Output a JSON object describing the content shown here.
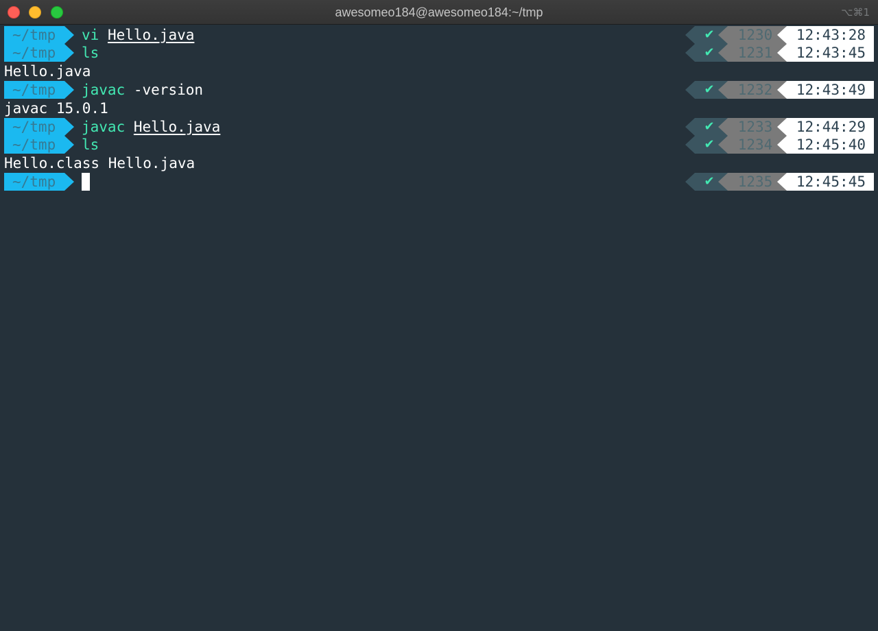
{
  "window": {
    "title": "awesomeo184@awesomeo184:~/tmp",
    "shortcut": "⌥⌘1"
  },
  "colors": {
    "background": "#25313a",
    "dir_segment": "#1bb9f0",
    "command": "#43e8b2",
    "status_segment": "#3b5560",
    "history_segment": "#7a7a7a",
    "time_segment": "#ffffff"
  },
  "terminal": {
    "lines": [
      {
        "type": "prompt",
        "dir": "~/tmp",
        "cmd": "vi",
        "arg": "Hello.java",
        "status": "✔",
        "hist": "1230",
        "time": "12:43:28"
      },
      {
        "type": "prompt",
        "dir": "~/tmp",
        "cmd": "ls",
        "arg": "",
        "status": "✔",
        "hist": "1231",
        "time": "12:43:45"
      },
      {
        "type": "output",
        "text": "Hello.java"
      },
      {
        "type": "prompt",
        "dir": "~/tmp",
        "cmd": "javac",
        "arg": "-version",
        "status": "✔",
        "hist": "1232",
        "time": "12:43:49"
      },
      {
        "type": "output",
        "text": "javac 15.0.1"
      },
      {
        "type": "prompt",
        "dir": "~/tmp",
        "cmd": "javac",
        "arg": "Hello.java",
        "status": "✔",
        "hist": "1233",
        "time": "12:44:29"
      },
      {
        "type": "prompt",
        "dir": "~/tmp",
        "cmd": "ls",
        "arg": "",
        "status": "✔",
        "hist": "1234",
        "time": "12:45:40"
      },
      {
        "type": "output",
        "text": "Hello.class Hello.java"
      },
      {
        "type": "prompt",
        "dir": "~/tmp",
        "cmd": "",
        "arg": "",
        "status": "✔",
        "hist": "1235",
        "time": "12:45:45"
      }
    ]
  }
}
